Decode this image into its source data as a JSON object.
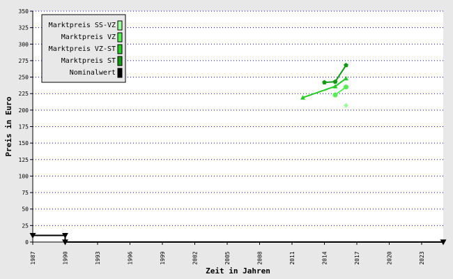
{
  "chart_data": {
    "type": "line",
    "xlabel": "Zeit in Jahren",
    "ylabel": "Preis in Euro",
    "xlim": [
      1987,
      2025
    ],
    "ylim": [
      0,
      350
    ],
    "x_ticks": [
      1987,
      1990,
      1993,
      1996,
      1999,
      2002,
      2005,
      2008,
      2011,
      2014,
      2017,
      2020,
      2023
    ],
    "y_ticks": [
      0,
      25,
      50,
      75,
      100,
      125,
      150,
      175,
      200,
      225,
      250,
      275,
      300,
      325,
      350
    ],
    "grid": true,
    "legend_position": "top-left",
    "series": [
      {
        "name": "Marktpreis SS-VZ",
        "color": "#99ff99",
        "marker": "diamond",
        "points": [
          [
            2016,
            207
          ]
        ]
      },
      {
        "name": "Marktpreis VZ",
        "color": "#55ee55",
        "marker": "circle",
        "points": [
          [
            2015,
            223
          ],
          [
            2016,
            235
          ]
        ]
      },
      {
        "name": "Marktpreis VZ-ST",
        "color": "#22cc22",
        "marker": "triangle-up",
        "points": [
          [
            2012,
            219
          ],
          [
            2015,
            236
          ],
          [
            2016,
            248
          ]
        ]
      },
      {
        "name": "Marktpreis ST",
        "color": "#119911",
        "marker": "pentagon",
        "points": [
          [
            2014,
            242
          ],
          [
            2015,
            243
          ],
          [
            2016,
            268
          ]
        ]
      },
      {
        "name": "Nominalwert",
        "color": "#000000",
        "marker": "triangle-down",
        "points": [
          [
            1987,
            10
          ],
          [
            1990,
            10
          ],
          [
            1990,
            0
          ],
          [
            2025,
            0
          ]
        ]
      }
    ]
  }
}
